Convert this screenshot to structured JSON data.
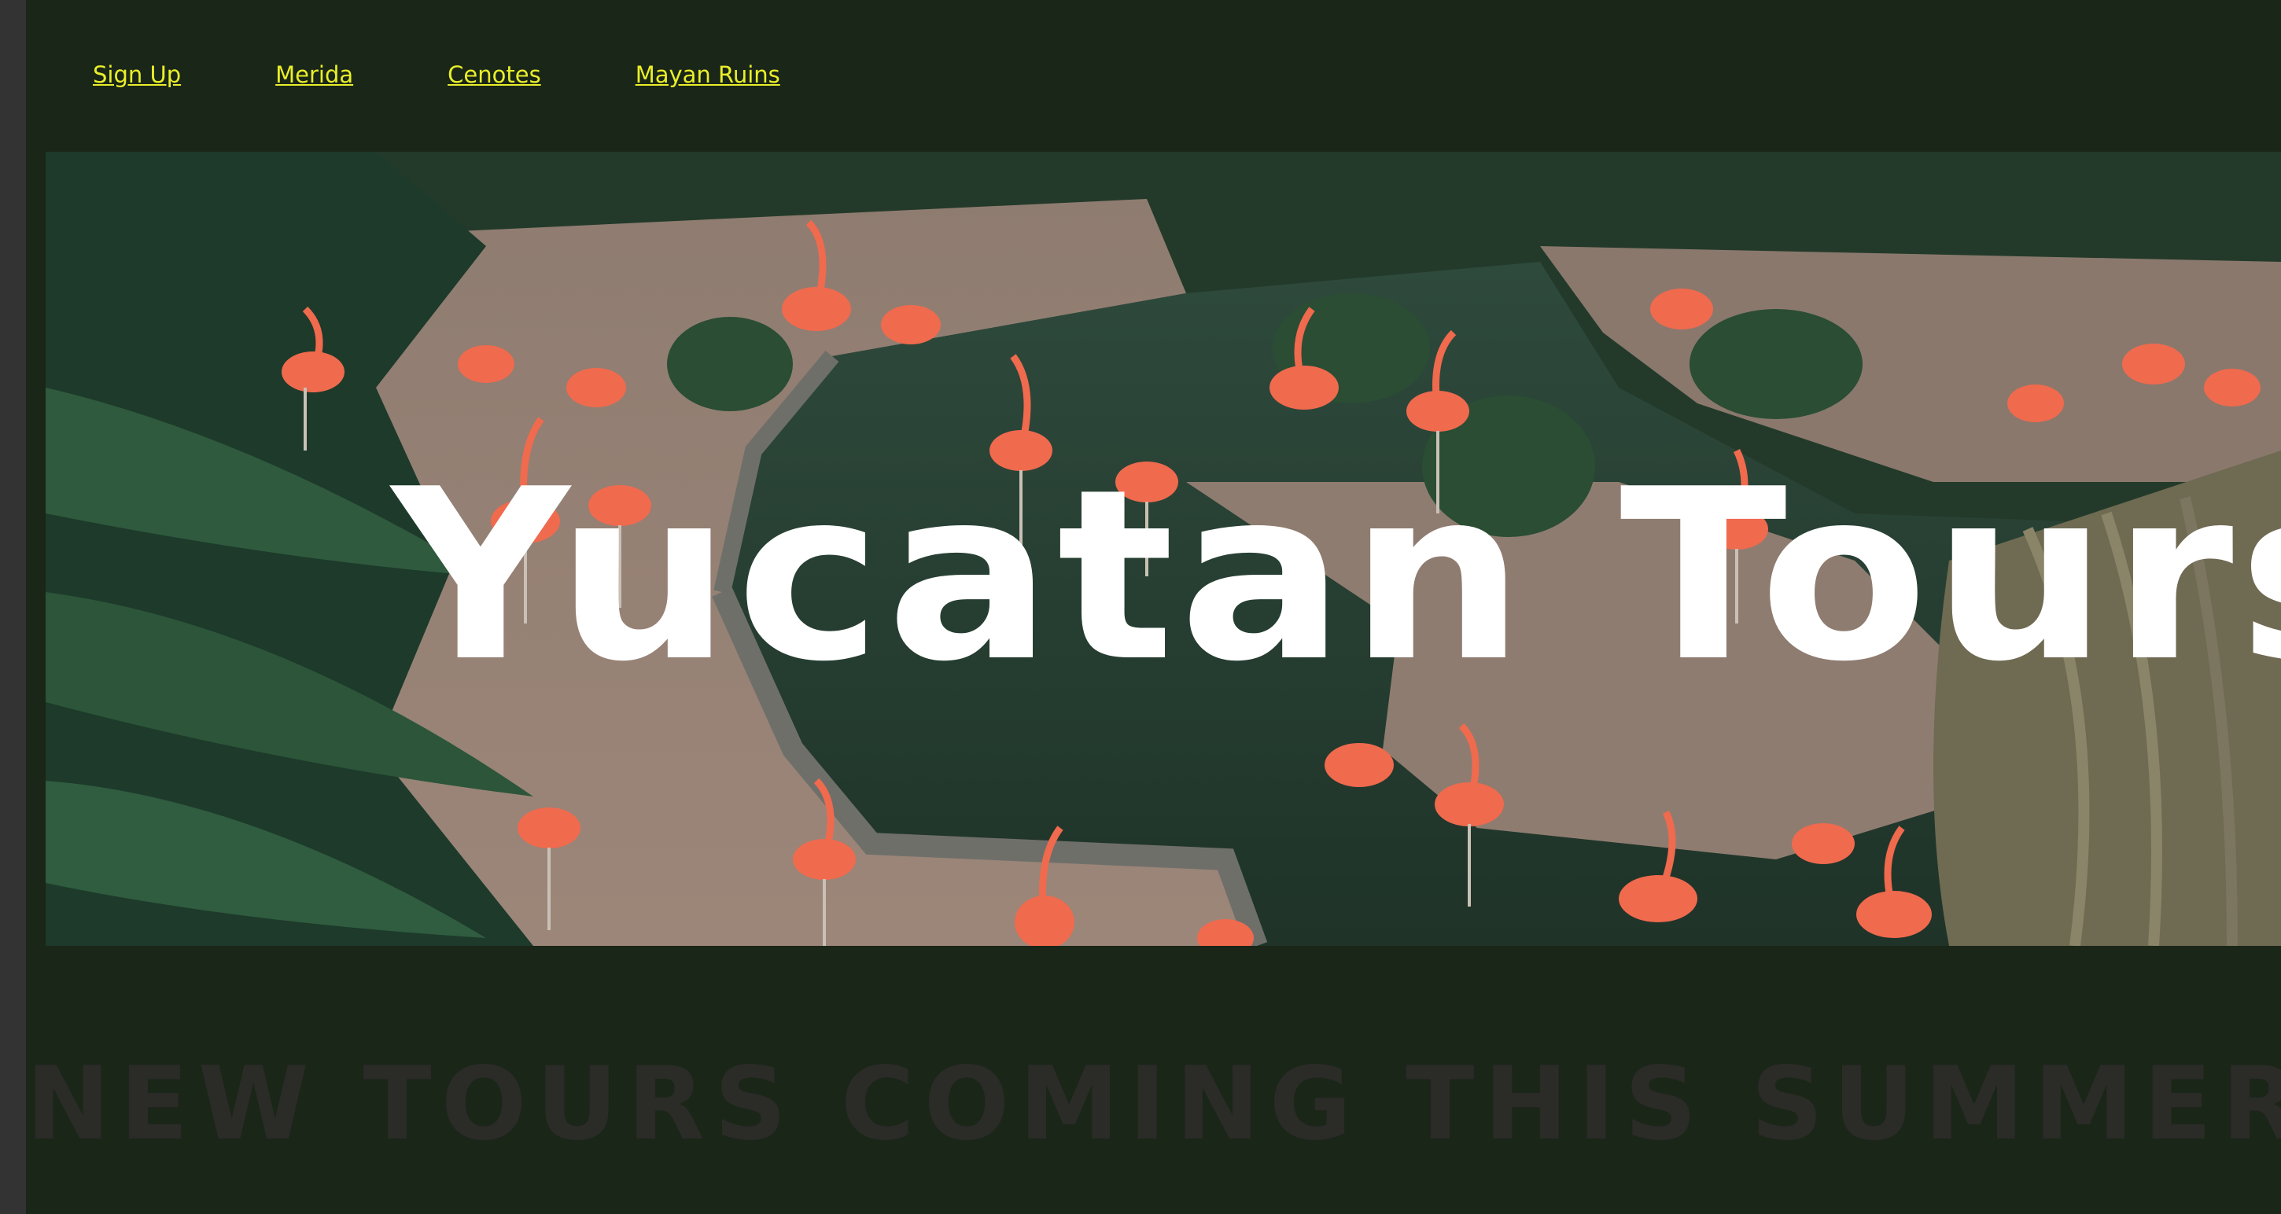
{
  "nav": {
    "links": [
      {
        "label": "Sign Up"
      },
      {
        "label": "Merida"
      },
      {
        "label": "Cenotes"
      },
      {
        "label": "Mayan Ruins"
      }
    ]
  },
  "hero": {
    "title": "Yucatan Tours",
    "image_subject": "flamingos-lagoon"
  },
  "announcement": {
    "text": "NEW TOURS COMING THIS SUMMER!"
  },
  "colors": {
    "page_background": "#1a2617",
    "link": "#e9ee2a",
    "hero_title": "#ffffff",
    "announcement_text": "#2b2b28",
    "gutter": "#333333"
  }
}
